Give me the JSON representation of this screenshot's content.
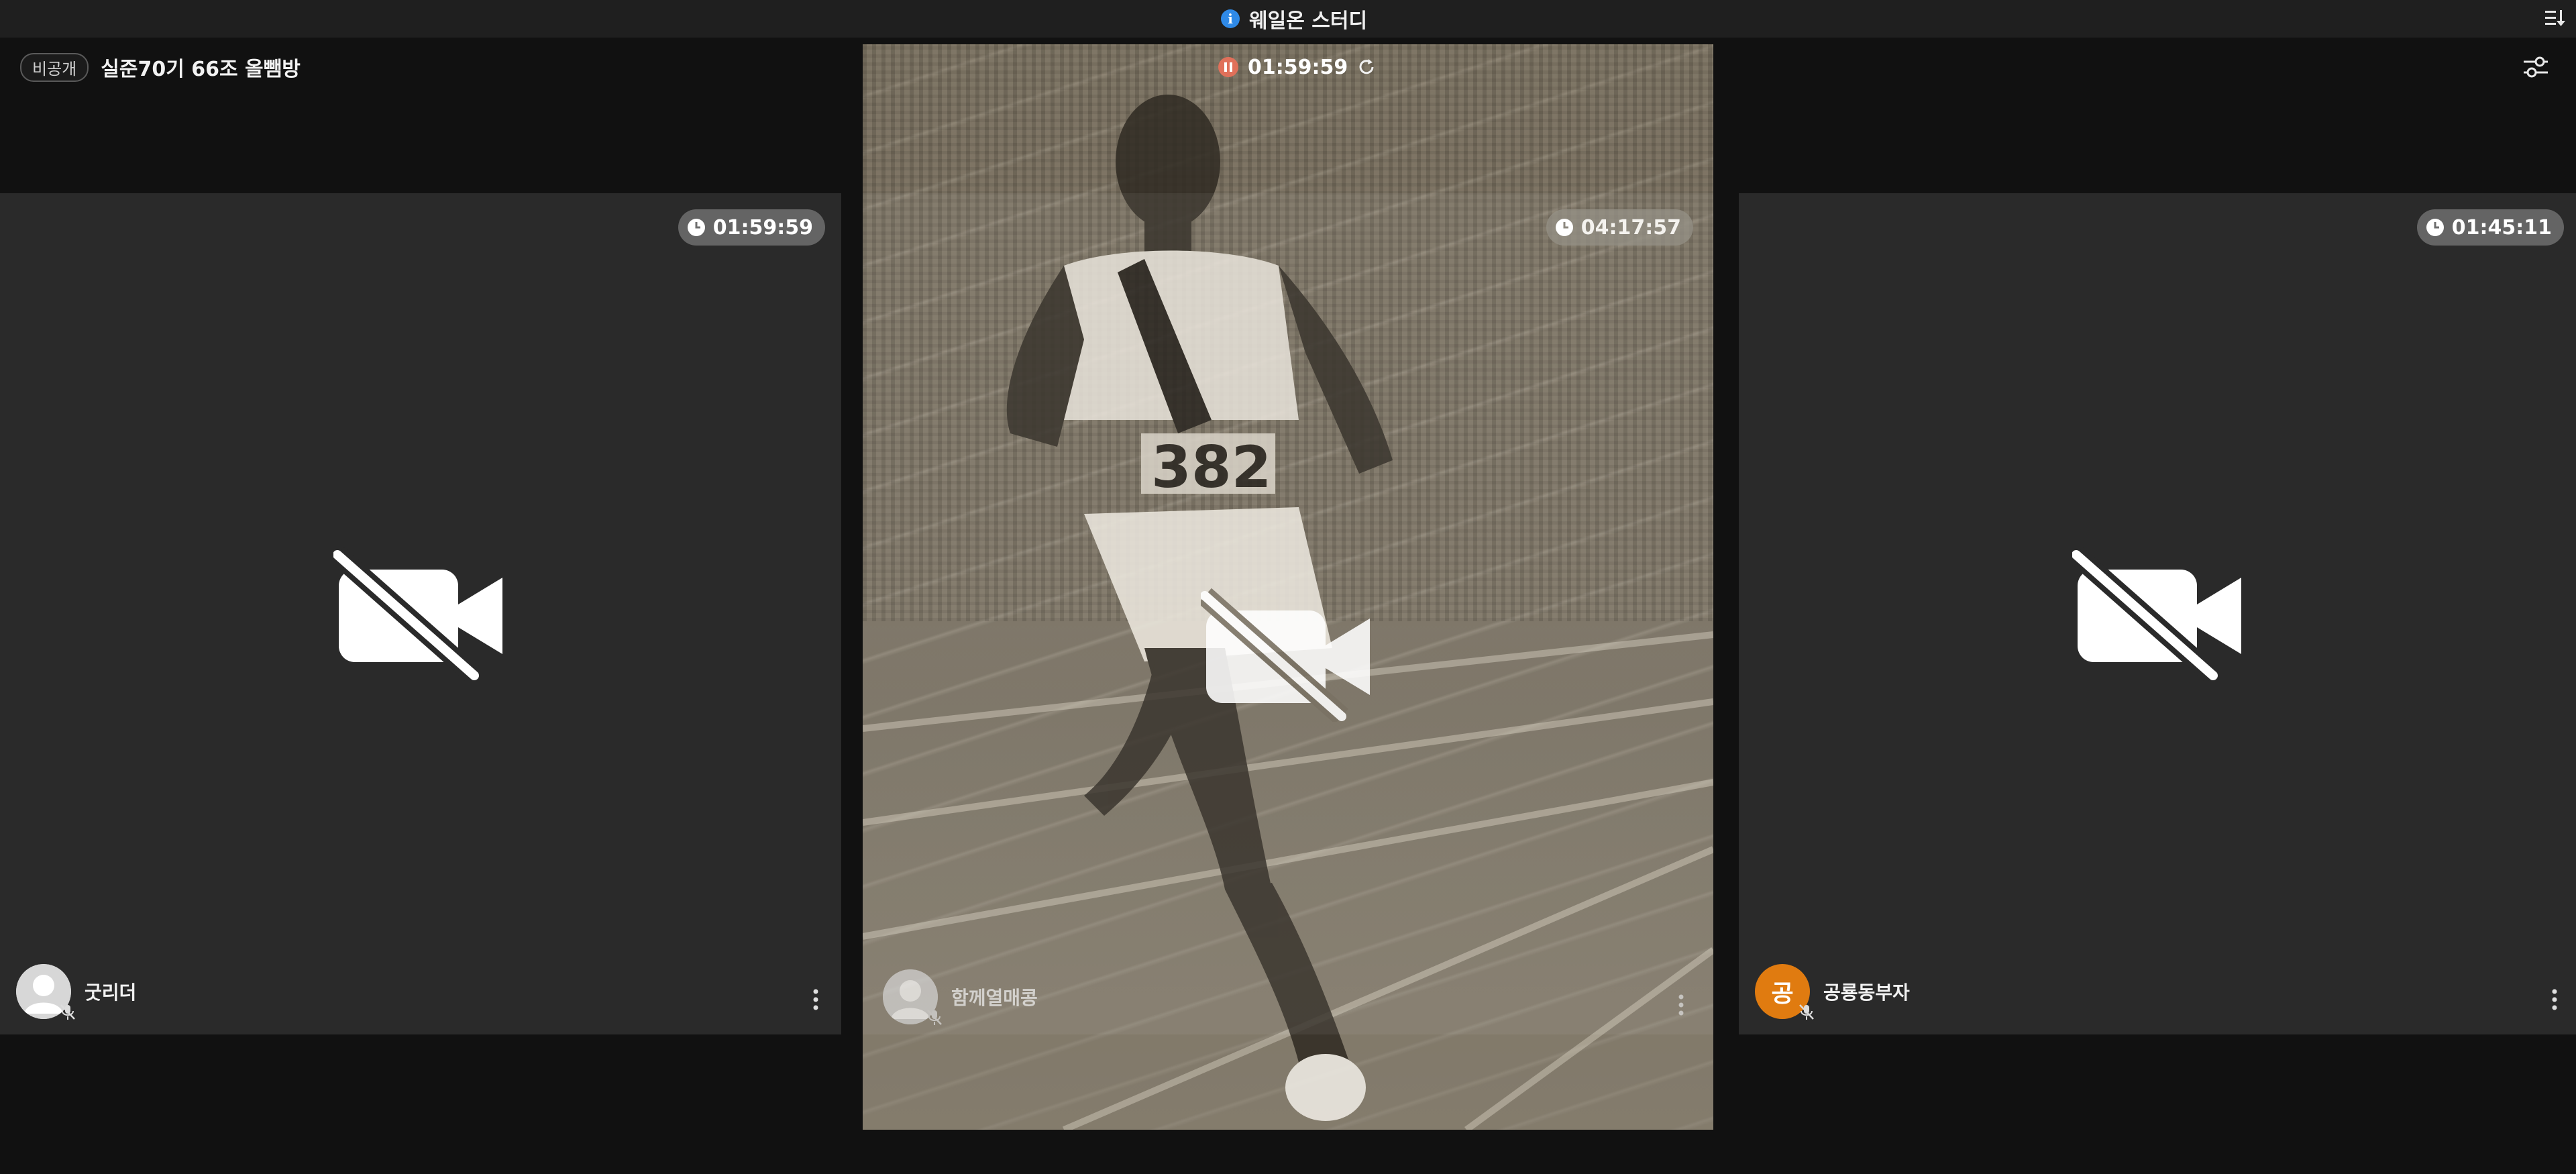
{
  "topbar": {
    "title": "웨일온 스터디",
    "info_icon": "info-icon",
    "sort_icon": "sort-list-icon"
  },
  "room": {
    "visibility_badge": "비공개",
    "title": "실준70기 66조 올뺌방",
    "settings_icon": "settings-sliders-icon"
  },
  "session_timer": {
    "time": "01:59:59",
    "pause_icon": "pause-icon",
    "refresh_icon": "refresh-icon"
  },
  "tiles": [
    {
      "position": "left",
      "timer": "01:59:59",
      "camera_state": "off",
      "participant": {
        "name": "굿리더",
        "avatar": "default-person",
        "mic": "off"
      }
    },
    {
      "position": "center",
      "timer": "04:17:57",
      "camera_state": "off",
      "background": "marathon-runner-photo",
      "participant": {
        "name": "함께열매콩",
        "avatar": "default-person",
        "mic": "off"
      }
    },
    {
      "position": "right",
      "timer": "01:45:11",
      "camera_state": "off",
      "participant": {
        "name": "공룡동부자",
        "avatar_initial": "공",
        "mic": "off"
      }
    }
  ],
  "colors": {
    "background": "#111111",
    "topbar": "#1f1f1f",
    "tile": "#2a2a2a",
    "info_blue": "#2f8ae8",
    "avatar_orange": "#e07b10",
    "pause_red": "#e0705a"
  }
}
